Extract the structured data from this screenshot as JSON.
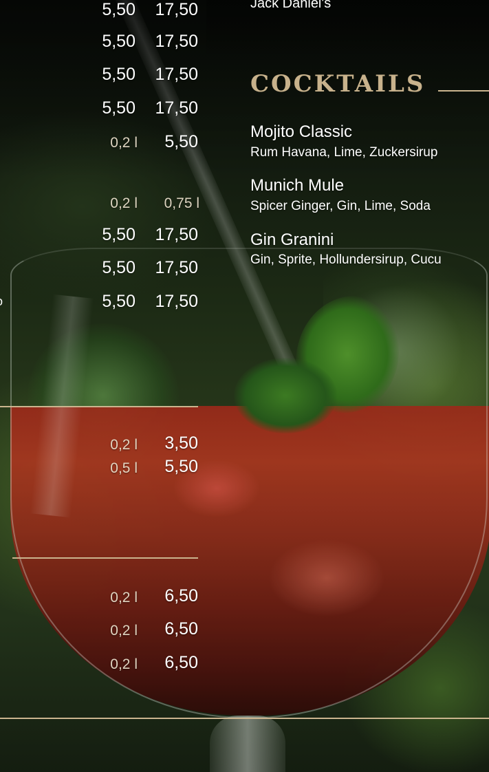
{
  "left_column": {
    "rows_a": [
      {
        "price1": "5,50",
        "price2": "17,50"
      },
      {
        "price1": "5,50",
        "price2": "17,50"
      },
      {
        "price1": "5,50",
        "price2": "17,50"
      },
      {
        "price1": "5,50",
        "price2": "17,50"
      }
    ],
    "row_small": {
      "volume": "0,2 l",
      "price": "5,50"
    },
    "header_volumes": {
      "small": "0,2 l",
      "large": "0,75 l"
    },
    "rows_b": [
      {
        "price1": "5,50",
        "price2": "17,50"
      },
      {
        "price1": "5,50",
        "price2": "17,50"
      },
      {
        "price1": "5,50",
        "price2": "17,50"
      }
    ],
    "edge_fragment": "o",
    "rows_c": [
      {
        "volume": "0,2 l",
        "price": "3,50"
      },
      {
        "volume": "0,5 l",
        "price": "5,50"
      }
    ],
    "rows_d": [
      {
        "volume": "0,2 l",
        "price": "6,50"
      },
      {
        "volume": "0,2 l",
        "price": "6,50"
      },
      {
        "volume": "0,2 l",
        "price": "6,50"
      }
    ]
  },
  "right_column": {
    "top_item": "Jack Daniel's",
    "section_title": "COCKTAILS",
    "cocktails": [
      {
        "name": "Mojito Classic",
        "desc": "Rum Havana, Lime, Zuckersirup"
      },
      {
        "name": "Munich Mule",
        "desc": "Spicer Ginger, Gin, Lime, Soda"
      },
      {
        "name": "Gin Granini",
        "desc": "Gin, Sprite, Hollundersirup, Cucu"
      }
    ]
  },
  "colors": {
    "accent_gold": "#c8b28c",
    "divider": "#cbb58f",
    "text": "#ffffff"
  }
}
